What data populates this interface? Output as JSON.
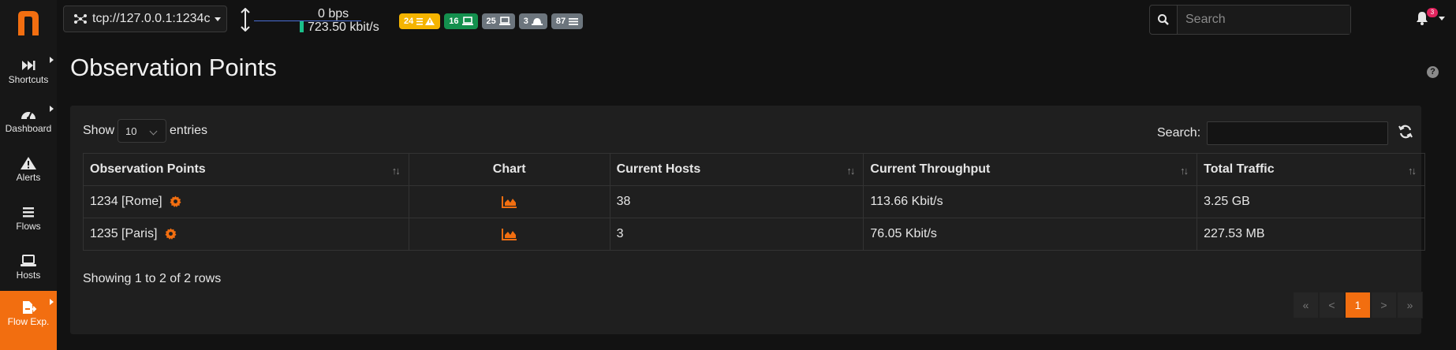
{
  "sidebar": {
    "logo": "n",
    "items": [
      {
        "label": "Shortcuts",
        "icon": "fast-forward-icon"
      },
      {
        "label": "Dashboard",
        "icon": "gauge-icon"
      },
      {
        "label": "Alerts",
        "icon": "warning-icon"
      },
      {
        "label": "Flows",
        "icon": "bars-icon"
      },
      {
        "label": "Hosts",
        "icon": "laptop-icon"
      },
      {
        "label": "Flow Exp.",
        "icon": "file-export-icon"
      }
    ]
  },
  "header": {
    "interface": "tcp://127.0.0.1:1234c",
    "throughput_up": "0 bps",
    "throughput_down": "723.50 kbit/s",
    "badges": [
      {
        "count": "24",
        "icon": "list-warning-icon",
        "color": "#f5b400"
      },
      {
        "count": "16",
        "icon": "laptop-icon",
        "color": "#14904e"
      },
      {
        "count": "25",
        "icon": "laptop-icon",
        "color": "#6c757d"
      },
      {
        "count": "3",
        "icon": "hat-icon",
        "color": "#6c757d"
      },
      {
        "count": "87",
        "icon": "bars-icon",
        "color": "#6c757d"
      }
    ],
    "search_placeholder": "Search",
    "notifications": "3"
  },
  "page": {
    "title": "Observation Points",
    "help": "?"
  },
  "table": {
    "show_label": "Show",
    "entries_value": "10",
    "entries_label": "entries",
    "search_label": "Search:",
    "columns": [
      "Observation Points",
      "Chart",
      "Current Hosts",
      "Current Throughput",
      "Total Traffic"
    ],
    "rows": [
      {
        "name": "1234 [Rome]",
        "hosts": "38",
        "throughput": "113.66 Kbit/s",
        "traffic": "3.25 GB"
      },
      {
        "name": "1235 [Paris]",
        "hosts": "3",
        "throughput": "76.05 Kbit/s",
        "traffic": "227.53 MB"
      }
    ],
    "info": "Showing 1 to 2 of 2 rows",
    "pagination": [
      "«",
      "<",
      "1",
      ">",
      "»"
    ]
  },
  "colors": {
    "accent": "#f26e10",
    "background": "#121212",
    "card": "#1f1f1f"
  }
}
